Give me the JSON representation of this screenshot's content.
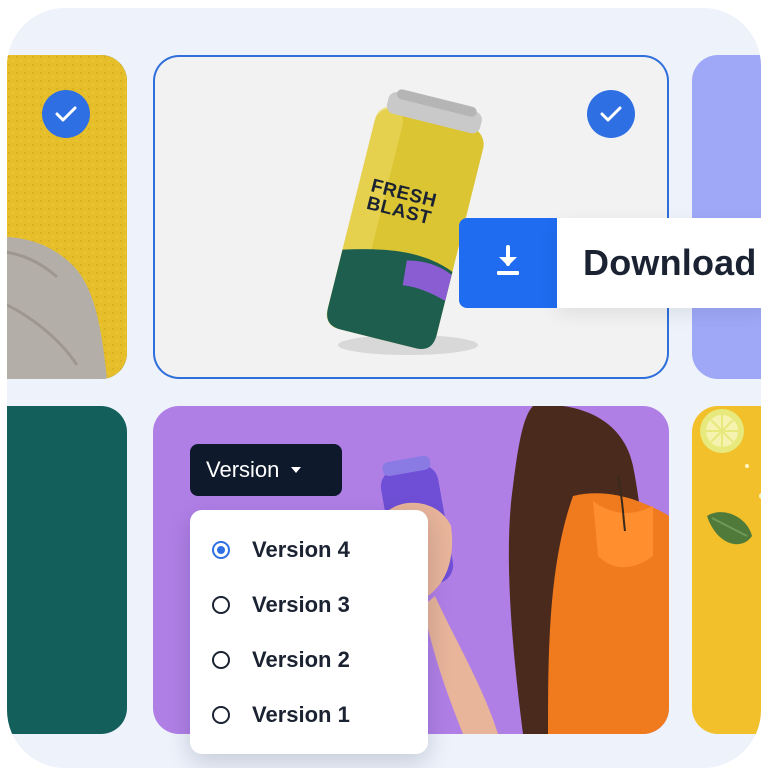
{
  "download": {
    "label": "Download",
    "icon": "download-icon"
  },
  "can": {
    "brand_line1": "FRESH",
    "brand_line2": "BLAST"
  },
  "version_menu": {
    "button_label": "Version",
    "options": [
      {
        "label": "Version 4",
        "selected": true
      },
      {
        "label": "Version 3",
        "selected": false
      },
      {
        "label": "Version 2",
        "selected": false
      },
      {
        "label": "Version 1",
        "selected": false
      }
    ]
  },
  "colors": {
    "accent": "#2f6fe4",
    "download_button": "#1f6cf0",
    "teal_tile": "#135f5b",
    "purple_tile": "#b07fe6",
    "lavender_tile": "#9ea8f7",
    "yellow": "#f2c02a"
  }
}
